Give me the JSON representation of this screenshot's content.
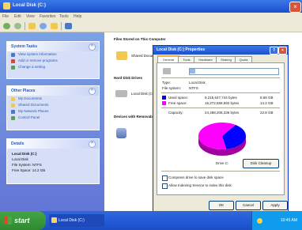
{
  "window": {
    "title": "Local Disk (C:)",
    "close_label": "×"
  },
  "menu": [
    "File",
    "Edit",
    "View",
    "Favorites",
    "Tools",
    "Help"
  ],
  "toolbar": [
    "back",
    "forward",
    "up",
    "search",
    "folders",
    "views"
  ],
  "left_pane": {
    "system_tasks": {
      "title": "System Tasks",
      "items": [
        "View system information",
        "Add or remove programs",
        "Change a setting"
      ]
    },
    "other_places": {
      "title": "Other Places",
      "items": [
        "My Documents",
        "Shared Documents",
        "My Network Places",
        "Control Panel"
      ]
    },
    "details": {
      "title": "Details",
      "lines": [
        "Local Disk (C:)",
        "Local Disk",
        "File System: NTFS",
        "Free Space: 14.2 GB"
      ]
    }
  },
  "right_pane": {
    "heading": "Files Stored on This Computer",
    "files": [
      {
        "label": "Shared Documents"
      },
      {
        "label": "Hard Disk Drives"
      },
      {
        "label": "Local Disk (C:)"
      },
      {
        "label": "Devices with Removable Storage"
      }
    ]
  },
  "dialog": {
    "title": "Local Disk (C:) Properties",
    "help_label": "?",
    "close_label": "×",
    "tabs": [
      "General",
      "Tools",
      "Hardware",
      "Sharing",
      "Quota"
    ],
    "active_tab": 0,
    "label_value": "",
    "type_label": "Type:",
    "type_value": "Local Disk",
    "fs_label": "File system:",
    "fs_value": "NTFS",
    "used_label": "Used space:",
    "used_value": "9,215,647,744 bytes",
    "used_gb": "8.58 GB",
    "free_label": "Free space:",
    "free_value": "15,272,558,592 bytes",
    "free_gb": "14.2 GB",
    "capacity_label": "Capacity:",
    "capacity_value": "24,488,206,336 bytes",
    "capacity_gb": "22.8 GB",
    "drive_label": "Drive C:",
    "cleanup_label": "Disk Cleanup",
    "compress_label": "Compress drive to save disk space",
    "index_label": "Allow Indexing Service to index this disk",
    "buttons": [
      "OK",
      "Cancel",
      "Apply"
    ],
    "used_color": "#0000ff",
    "free_color": "#ff00ff"
  },
  "taskbar": {
    "start_label": "start",
    "task_label": "Local Disk (C:)",
    "clock": "10:45 AM"
  },
  "chart_data": {
    "type": "pie",
    "categories": [
      "Used space",
      "Free space"
    ],
    "values": [
      8.58,
      14.2
    ],
    "colors": [
      "#0000ff",
      "#ff00ff"
    ]
  }
}
